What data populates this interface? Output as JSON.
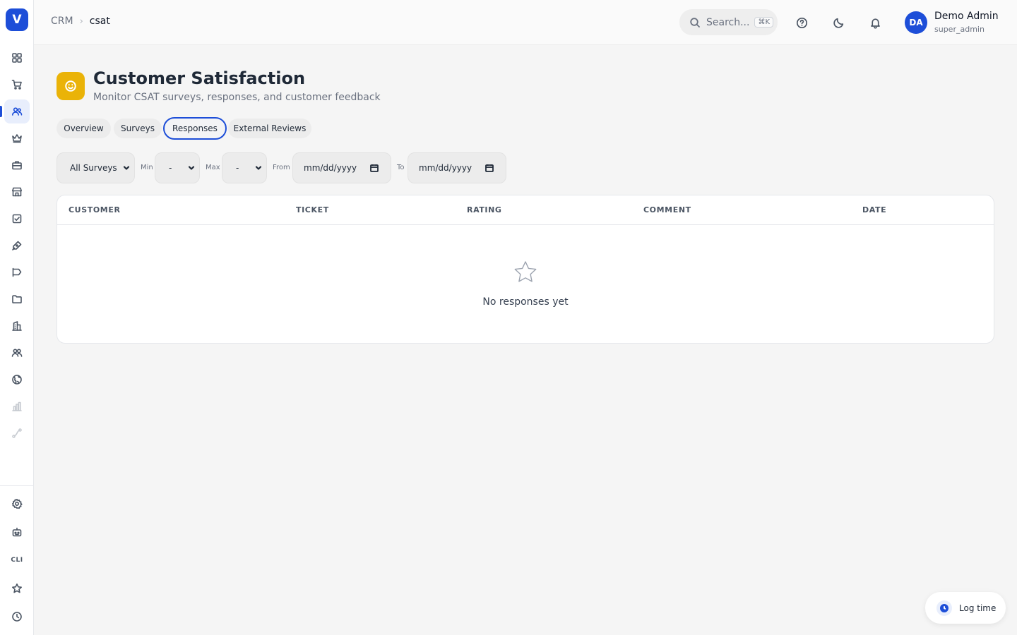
{
  "app": {
    "logo_letter": "V"
  },
  "breadcrumb": {
    "root": "CRM",
    "current": "csat"
  },
  "search": {
    "placeholder": "Search...",
    "shortcut": "⌘K"
  },
  "user": {
    "initials": "DA",
    "name": "Demo Admin",
    "role": "super_admin"
  },
  "sidebar": {
    "items": [
      {
        "icon": "grid-icon",
        "active": false
      },
      {
        "icon": "cart-icon",
        "active": false
      },
      {
        "icon": "users-icon",
        "active": true
      },
      {
        "icon": "crown-icon",
        "active": false
      },
      {
        "icon": "briefcase-icon",
        "active": false
      },
      {
        "icon": "store-icon",
        "active": false
      },
      {
        "icon": "checkbox-icon",
        "active": false
      },
      {
        "icon": "pen-icon",
        "active": false
      },
      {
        "icon": "megaphone-icon",
        "active": false
      },
      {
        "icon": "folder-icon",
        "active": false
      },
      {
        "icon": "building-icon",
        "active": false
      },
      {
        "icon": "team-icon",
        "active": false
      },
      {
        "icon": "globe-icon",
        "active": false
      },
      {
        "icon": "bar-chart-icon",
        "active": false
      },
      {
        "icon": "workflow-icon",
        "active": false
      }
    ],
    "bottom": [
      {
        "icon": "gear-icon"
      },
      {
        "icon": "bot-icon"
      },
      {
        "icon": "cli-icon",
        "label": "CLI"
      },
      {
        "icon": "star-icon"
      },
      {
        "icon": "clock-icon"
      }
    ]
  },
  "page": {
    "title": "Customer Satisfaction",
    "subtitle": "Monitor CSAT surveys, responses, and customer feedback",
    "icon": "smile-icon"
  },
  "tabs": [
    {
      "label": "Overview",
      "active": false
    },
    {
      "label": "Surveys",
      "active": false
    },
    {
      "label": "Responses",
      "active": true
    },
    {
      "label": "External Reviews",
      "active": false
    }
  ],
  "filters": {
    "survey": "All Surveys",
    "min_label": "Min",
    "min_value": "-",
    "max_label": "Max",
    "max_value": "-",
    "from_label": "From",
    "from_placeholder": "mm/dd/yyyy",
    "to_label": "To",
    "to_placeholder": "mm/dd/yyyy"
  },
  "table": {
    "columns": [
      "CUSTOMER",
      "TICKET",
      "RATING",
      "COMMENT",
      "DATE"
    ],
    "rows": [],
    "empty_text": "No responses yet"
  },
  "log_time": {
    "label": "Log time"
  },
  "colors": {
    "accent": "#1d4ed8",
    "page_icon": "#eab308",
    "background": "#f5f5f5"
  }
}
